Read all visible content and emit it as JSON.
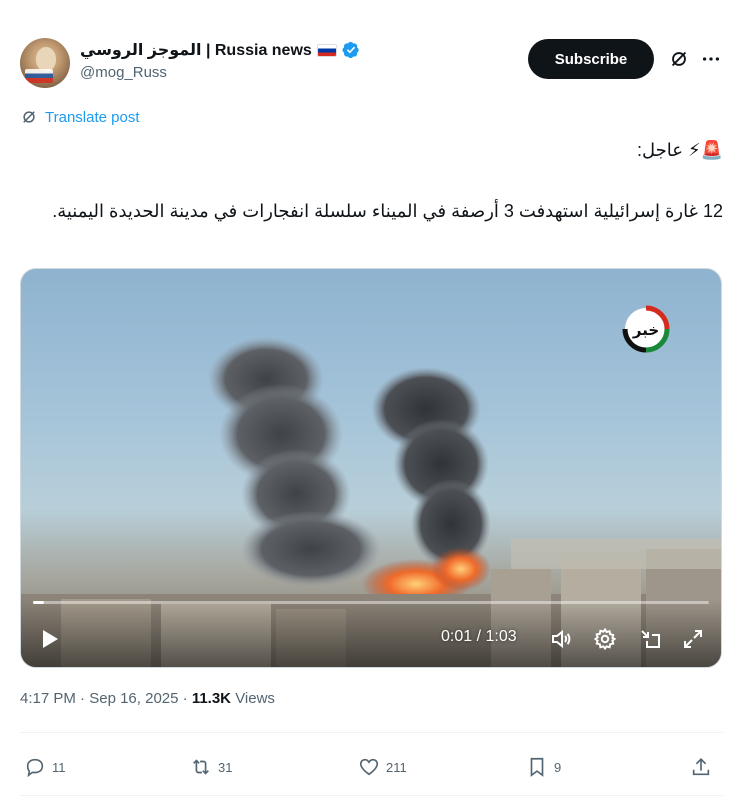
{
  "author": {
    "name": "الموجز الروسي | Russia news",
    "handle": "@mog_Russ",
    "avatar_icon": "avatar-russian-flag"
  },
  "header": {
    "subscribe_label": "Subscribe",
    "grok_icon": "grok-icon",
    "more_icon": "more-icon"
  },
  "translate": {
    "label": "Translate post"
  },
  "post": {
    "line1": "🚨⚡ عاجل:",
    "line2": "12 غارة إسرائيلية استهدفت 3 أرصفة في الميناء سلسلة انفجارات في مدينة الحديدة اليمنية."
  },
  "video": {
    "logo_text": "خبر",
    "current_time": "0:01",
    "duration": "1:03",
    "time_display": "0:01 / 1:03",
    "progress_fraction": 0.016
  },
  "meta": {
    "time": "4:17 PM",
    "date": "Sep 16, 2025",
    "views_count": "11.3K",
    "views_label": "Views"
  },
  "actions": {
    "replies": "11",
    "reposts": "31",
    "likes": "211",
    "bookmarks": "9"
  },
  "colors": {
    "accent": "#1d9bf0",
    "text": "#0f1419",
    "muted": "#536471"
  }
}
